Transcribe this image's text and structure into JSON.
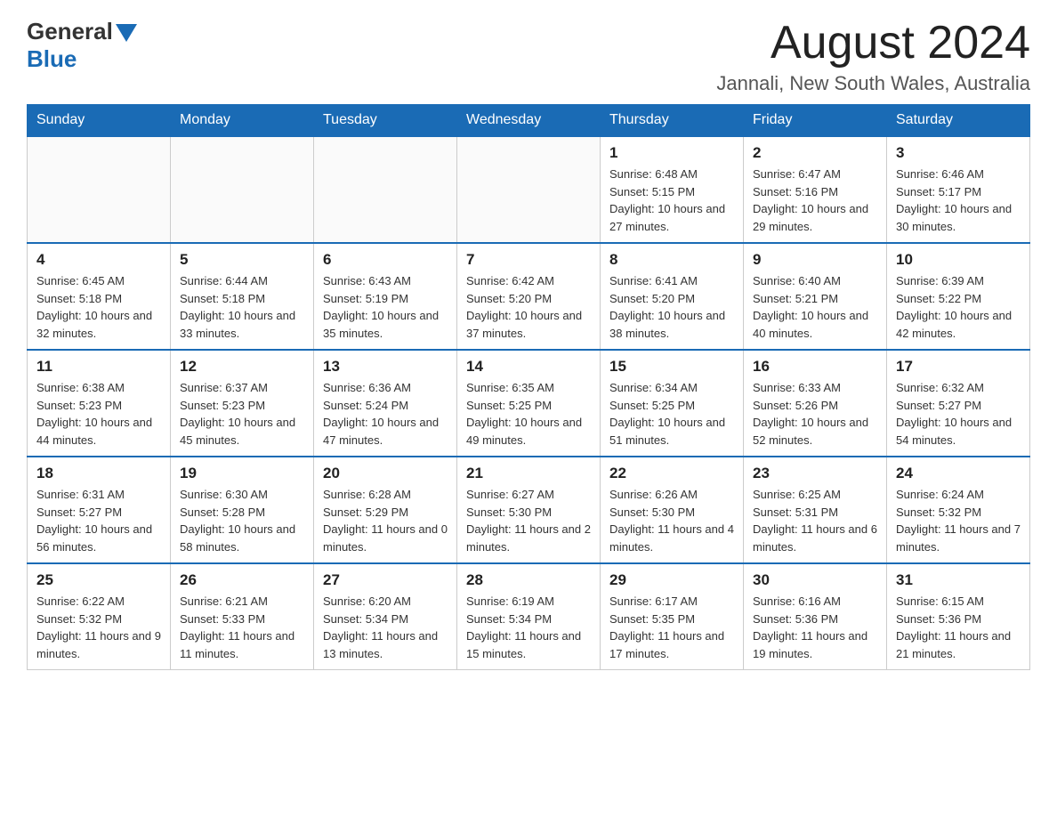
{
  "header": {
    "logo_general": "General",
    "logo_blue": "Blue",
    "month_title": "August 2024",
    "subtitle": "Jannali, New South Wales, Australia"
  },
  "days_of_week": [
    "Sunday",
    "Monday",
    "Tuesday",
    "Wednesday",
    "Thursday",
    "Friday",
    "Saturday"
  ],
  "weeks": [
    [
      {
        "day": "",
        "info": ""
      },
      {
        "day": "",
        "info": ""
      },
      {
        "day": "",
        "info": ""
      },
      {
        "day": "",
        "info": ""
      },
      {
        "day": "1",
        "info": "Sunrise: 6:48 AM\nSunset: 5:15 PM\nDaylight: 10 hours and 27 minutes."
      },
      {
        "day": "2",
        "info": "Sunrise: 6:47 AM\nSunset: 5:16 PM\nDaylight: 10 hours and 29 minutes."
      },
      {
        "day": "3",
        "info": "Sunrise: 6:46 AM\nSunset: 5:17 PM\nDaylight: 10 hours and 30 minutes."
      }
    ],
    [
      {
        "day": "4",
        "info": "Sunrise: 6:45 AM\nSunset: 5:18 PM\nDaylight: 10 hours and 32 minutes."
      },
      {
        "day": "5",
        "info": "Sunrise: 6:44 AM\nSunset: 5:18 PM\nDaylight: 10 hours and 33 minutes."
      },
      {
        "day": "6",
        "info": "Sunrise: 6:43 AM\nSunset: 5:19 PM\nDaylight: 10 hours and 35 minutes."
      },
      {
        "day": "7",
        "info": "Sunrise: 6:42 AM\nSunset: 5:20 PM\nDaylight: 10 hours and 37 minutes."
      },
      {
        "day": "8",
        "info": "Sunrise: 6:41 AM\nSunset: 5:20 PM\nDaylight: 10 hours and 38 minutes."
      },
      {
        "day": "9",
        "info": "Sunrise: 6:40 AM\nSunset: 5:21 PM\nDaylight: 10 hours and 40 minutes."
      },
      {
        "day": "10",
        "info": "Sunrise: 6:39 AM\nSunset: 5:22 PM\nDaylight: 10 hours and 42 minutes."
      }
    ],
    [
      {
        "day": "11",
        "info": "Sunrise: 6:38 AM\nSunset: 5:23 PM\nDaylight: 10 hours and 44 minutes."
      },
      {
        "day": "12",
        "info": "Sunrise: 6:37 AM\nSunset: 5:23 PM\nDaylight: 10 hours and 45 minutes."
      },
      {
        "day": "13",
        "info": "Sunrise: 6:36 AM\nSunset: 5:24 PM\nDaylight: 10 hours and 47 minutes."
      },
      {
        "day": "14",
        "info": "Sunrise: 6:35 AM\nSunset: 5:25 PM\nDaylight: 10 hours and 49 minutes."
      },
      {
        "day": "15",
        "info": "Sunrise: 6:34 AM\nSunset: 5:25 PM\nDaylight: 10 hours and 51 minutes."
      },
      {
        "day": "16",
        "info": "Sunrise: 6:33 AM\nSunset: 5:26 PM\nDaylight: 10 hours and 52 minutes."
      },
      {
        "day": "17",
        "info": "Sunrise: 6:32 AM\nSunset: 5:27 PM\nDaylight: 10 hours and 54 minutes."
      }
    ],
    [
      {
        "day": "18",
        "info": "Sunrise: 6:31 AM\nSunset: 5:27 PM\nDaylight: 10 hours and 56 minutes."
      },
      {
        "day": "19",
        "info": "Sunrise: 6:30 AM\nSunset: 5:28 PM\nDaylight: 10 hours and 58 minutes."
      },
      {
        "day": "20",
        "info": "Sunrise: 6:28 AM\nSunset: 5:29 PM\nDaylight: 11 hours and 0 minutes."
      },
      {
        "day": "21",
        "info": "Sunrise: 6:27 AM\nSunset: 5:30 PM\nDaylight: 11 hours and 2 minutes."
      },
      {
        "day": "22",
        "info": "Sunrise: 6:26 AM\nSunset: 5:30 PM\nDaylight: 11 hours and 4 minutes."
      },
      {
        "day": "23",
        "info": "Sunrise: 6:25 AM\nSunset: 5:31 PM\nDaylight: 11 hours and 6 minutes."
      },
      {
        "day": "24",
        "info": "Sunrise: 6:24 AM\nSunset: 5:32 PM\nDaylight: 11 hours and 7 minutes."
      }
    ],
    [
      {
        "day": "25",
        "info": "Sunrise: 6:22 AM\nSunset: 5:32 PM\nDaylight: 11 hours and 9 minutes."
      },
      {
        "day": "26",
        "info": "Sunrise: 6:21 AM\nSunset: 5:33 PM\nDaylight: 11 hours and 11 minutes."
      },
      {
        "day": "27",
        "info": "Sunrise: 6:20 AM\nSunset: 5:34 PM\nDaylight: 11 hours and 13 minutes."
      },
      {
        "day": "28",
        "info": "Sunrise: 6:19 AM\nSunset: 5:34 PM\nDaylight: 11 hours and 15 minutes."
      },
      {
        "day": "29",
        "info": "Sunrise: 6:17 AM\nSunset: 5:35 PM\nDaylight: 11 hours and 17 minutes."
      },
      {
        "day": "30",
        "info": "Sunrise: 6:16 AM\nSunset: 5:36 PM\nDaylight: 11 hours and 19 minutes."
      },
      {
        "day": "31",
        "info": "Sunrise: 6:15 AM\nSunset: 5:36 PM\nDaylight: 11 hours and 21 minutes."
      }
    ]
  ]
}
